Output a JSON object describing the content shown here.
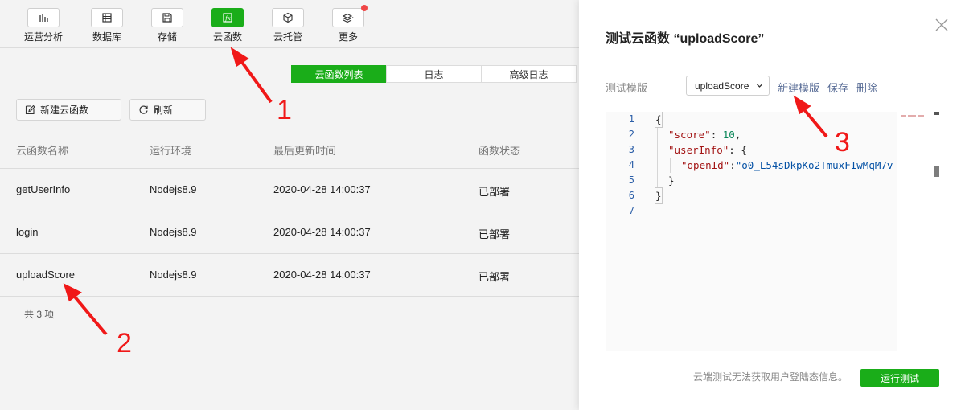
{
  "toolbar": {
    "items": [
      {
        "label": "运营分析",
        "icon": "bar-chart-icon"
      },
      {
        "label": "数据库",
        "icon": "database-icon"
      },
      {
        "label": "存储",
        "icon": "storage-icon"
      },
      {
        "label": "云函数",
        "icon": "cloud-function-icon",
        "active": true
      },
      {
        "label": "云托管",
        "icon": "cube-icon"
      },
      {
        "label": "更多",
        "icon": "layers-icon",
        "badge": true
      }
    ]
  },
  "tabs": [
    "云函数列表",
    "日志",
    "高级日志"
  ],
  "actions": {
    "new_function": "新建云函数",
    "refresh": "刷新"
  },
  "table": {
    "headers": [
      "云函数名称",
      "运行环境",
      "最后更新时间",
      "函数状态"
    ],
    "rows": [
      [
        "getUserInfo",
        "Nodejs8.9",
        "2020-04-28 14:00:37",
        "已部署"
      ],
      [
        "login",
        "Nodejs8.9",
        "2020-04-28 14:00:37",
        "已部署"
      ],
      [
        "uploadScore",
        "Nodejs8.9",
        "2020-04-28 14:00:37",
        "已部署"
      ]
    ],
    "total": "共 3 项"
  },
  "panel": {
    "title": "测试云函数 “uploadScore”",
    "template_label": "测试模版",
    "template_value": "uploadScore",
    "new_template": "新建模版",
    "save": "保存",
    "delete": "删除",
    "line_numbers": [
      "1",
      "2",
      "3",
      "4",
      "5",
      "6",
      "7"
    ],
    "code": {
      "l1": "{",
      "l2_key": "\"score\"",
      "l2_sep": ": ",
      "l2_val": "10",
      "l2_end": ",",
      "l3_key": "\"userInfo\"",
      "l3_sep": ": {",
      "l4_key": "\"openId\"",
      "l4_sep": ":",
      "l4_val": "\"o0_L54sDkpKo2TmuxFIwMqM7v",
      "l5": "}",
      "l6": "}"
    },
    "hint": "云端测试无法获取用户登陆态信息。",
    "run_button": "运行测试"
  },
  "annotations": [
    "1",
    "2",
    "3"
  ],
  "colors": {
    "accent": "#1aad19",
    "link": "#576b95",
    "annotation": "#f01818"
  }
}
